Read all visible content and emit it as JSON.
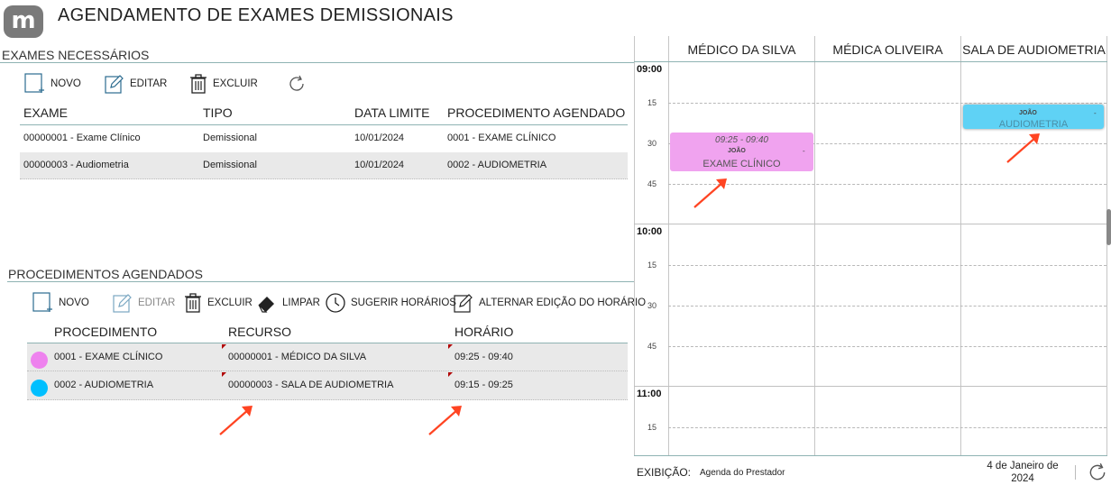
{
  "app": {
    "logo_letter": "m",
    "title": "AGENDAMENTO DE EXAMES DEMISSIONAIS"
  },
  "exames": {
    "title": "EXAMES NECESSÁRIOS",
    "toolbar": {
      "novo": "NOVO",
      "editar": "EDITAR",
      "excluir": "EXCLUIR"
    },
    "columns": [
      "EXAME",
      "TIPO",
      "DATA LIMITE",
      "PROCEDIMENTO AGENDADO"
    ],
    "rows": [
      {
        "exame": "00000001 - Exame Clínico",
        "tipo": "Demissional",
        "data": "10/01/2024",
        "procedimento": "0001 - EXAME CLÍNICO"
      },
      {
        "exame": "00000003 - Audiometria",
        "tipo": "Demissional",
        "data": "10/01/2024",
        "procedimento": "0002 - AUDIOMETRIA"
      }
    ]
  },
  "procedimentos": {
    "title": "PROCEDIMENTOS AGENDADOS",
    "toolbar": {
      "novo": "NOVO",
      "editar": "EDITAR",
      "excluir": "EXCLUIR",
      "limpar": "LIMPAR",
      "sugerir": "SUGERIR HORÁRIOS",
      "alternar": "ALTERNAR EDIÇÃO DO HORÁRIO"
    },
    "columns": [
      "PROCEDIMENTO",
      "RECURSO",
      "HORÁRIO"
    ],
    "rows": [
      {
        "color": "#ee82ee",
        "procedimento": "0001 - EXAME CLÍNICO",
        "recurso": "00000001 - MÉDICO DA SILVA",
        "horario": "09:25 - 09:40"
      },
      {
        "color": "#00bfff",
        "procedimento": "0002 - AUDIOMETRIA",
        "recurso": "00000003 - SALA DE AUDIOMETRIA",
        "horario": "09:15 - 09:25"
      }
    ]
  },
  "calendar": {
    "resources": [
      "MÉDICO DA SILVA",
      "MÉDICA OLIVEIRA",
      "SALA DE AUDIOMETRIA"
    ],
    "hours": [
      "09:00",
      "10:00",
      "11:00"
    ],
    "minutes": [
      "15",
      "30",
      "45"
    ],
    "events": [
      {
        "time": "09:25 - 09:40",
        "who": "JOÃO",
        "dash": "-",
        "name": "EXAME CLÍNICO",
        "color": "#f0a3ef"
      },
      {
        "who": "JOÃO",
        "dash": "-",
        "name": "AUDIOMETRIA",
        "color": "#5fd2f5"
      }
    ],
    "footer": {
      "label": "EXIBIÇÃO:",
      "value": "Agenda do Prestador",
      "date_line1": "4 de Janeiro de",
      "date_line2": "2024"
    }
  },
  "colors": {
    "accent_line": "#8fb3b3",
    "pink_event": "#f0a3ef",
    "cyan_event": "#5fd2f5",
    "annotation_arrow": "#ff4422"
  },
  "icons": [
    "logo-icon",
    "new-icon",
    "edit-icon",
    "trash-icon",
    "refresh-icon",
    "eraser-icon",
    "clock-icon",
    "edit-time-icon"
  ]
}
